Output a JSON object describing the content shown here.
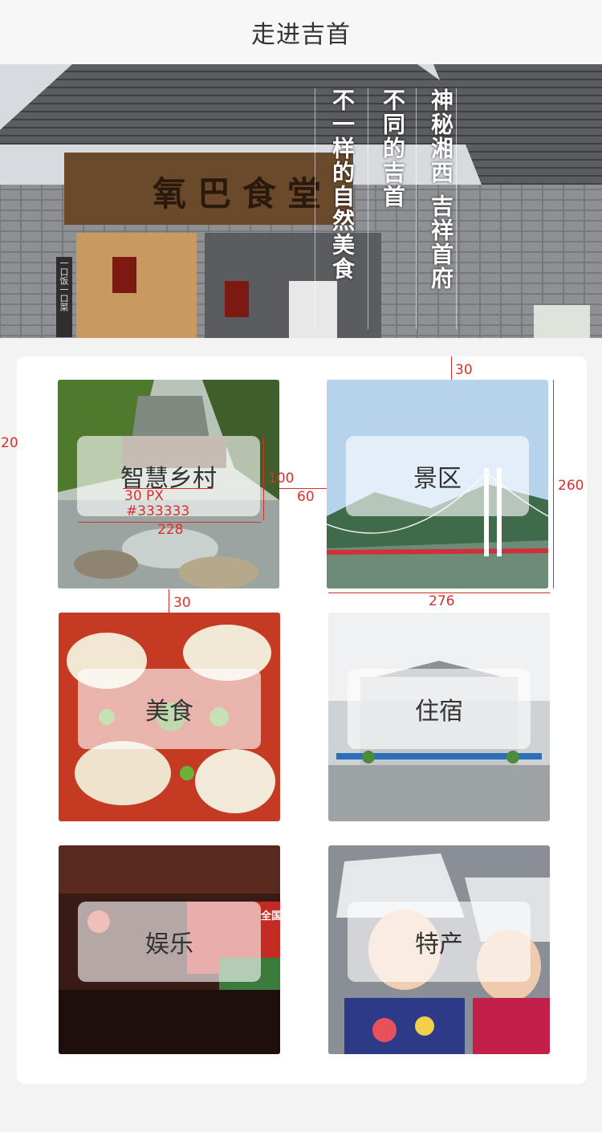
{
  "header": {
    "title": "走进吉首"
  },
  "banner": {
    "sign_text": "氧巴食堂",
    "columns": [
      "神秘湘西 吉祥首府",
      "不同的吉首",
      "不一样的自然美食"
    ],
    "side_sign": "一口饭一口菜"
  },
  "tiles": [
    {
      "label": "智慧乡村",
      "scene": "mountain-village"
    },
    {
      "label": "景区",
      "scene": "bridge"
    },
    {
      "label": "美食",
      "scene": "food"
    },
    {
      "label": "住宿",
      "scene": "hotel"
    },
    {
      "label": "娱乐",
      "scene": "conference"
    },
    {
      "label": "特产",
      "scene": "costume"
    }
  ],
  "photos": {
    "conference_banner": "全国交流大会"
  },
  "annotations": {
    "margin_left": "20",
    "label_height": "100",
    "gap_horizontal": "60",
    "font_size": "30 PX",
    "font_color": "#333333",
    "label_width": "228",
    "gap_vertical": "30",
    "top_margin": "30",
    "tile_height": "260",
    "tile_width": "276"
  },
  "colors": {
    "annotation": "#d9302c",
    "text": "#333333",
    "page_bg": "#f3f3f3"
  }
}
